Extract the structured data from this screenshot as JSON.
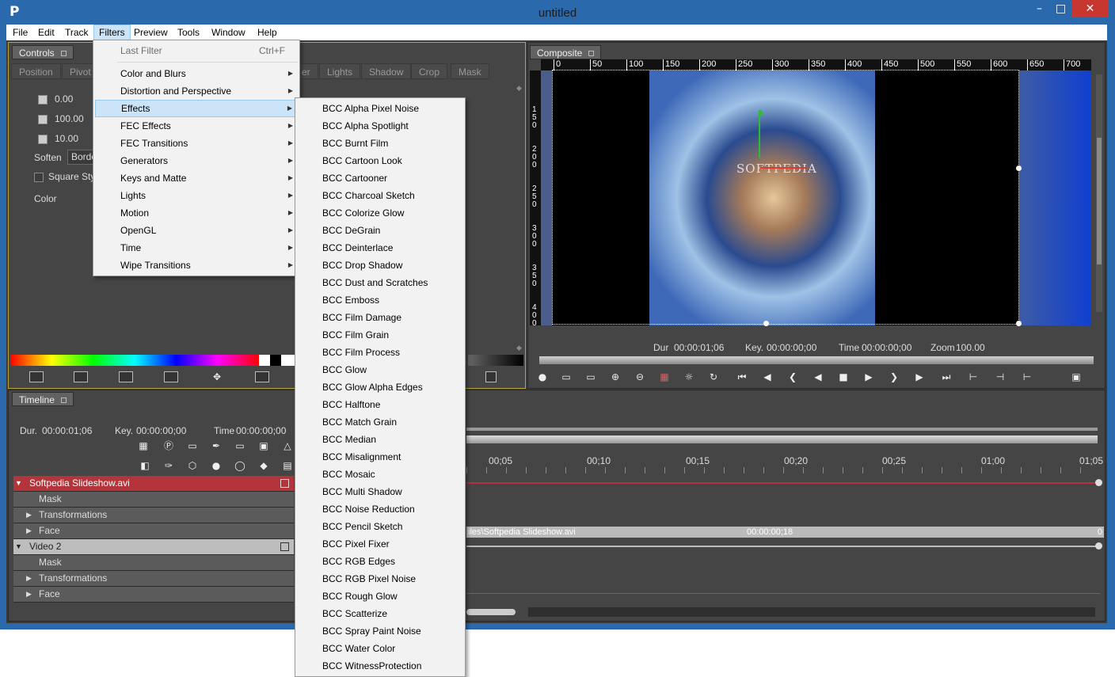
{
  "window": {
    "title": "untitled"
  },
  "menubar": [
    "File",
    "Edit",
    "Track",
    "Filters",
    "Preview",
    "Tools",
    "Window",
    "Help"
  ],
  "filters_menu": {
    "last_filter": "Last Filter",
    "last_filter_shortcut": "Ctrl+F",
    "items": [
      "Color and Blurs",
      "Distortion and Perspective",
      "Effects",
      "FEC Effects",
      "FEC Transitions",
      "Generators",
      "Keys and Matte",
      "Lights",
      "Motion",
      "OpenGL",
      "Time",
      "Wipe Transitions"
    ],
    "highlighted": "Effects"
  },
  "effects_submenu": [
    "BCC Alpha Pixel Noise",
    "BCC Alpha Spotlight",
    "BCC Burnt Film",
    "BCC Cartoon Look",
    "BCC Cartooner",
    "BCC Charcoal Sketch",
    "BCC Colorize Glow",
    "BCC DeGrain",
    "BCC Deinterlace",
    "BCC Drop Shadow",
    "BCC Dust and Scratches",
    "BCC Emboss",
    "BCC Film Damage",
    "BCC Film Grain",
    "BCC Film Process",
    "BCC Glow",
    "BCC Glow Alpha Edges",
    "BCC Halftone",
    "BCC Match Grain",
    "BCC Median",
    "BCC Misalignment",
    "BCC Mosaic",
    "BCC Multi Shadow",
    "BCC Noise Reduction",
    "BCC Pencil Sketch",
    "BCC Pixel Fixer",
    "BCC RGB Edges",
    "BCC RGB Pixel Noise",
    "BCC Rough Glow",
    "BCC Scatterize",
    "BCC Spray Paint Noise",
    "BCC Water Color",
    "BCC WitnessProtection"
  ],
  "controls": {
    "tab": "Controls",
    "subtabs": [
      "Position",
      "Pivot",
      "er",
      "Lights",
      "Shadow",
      "Crop",
      "Mask"
    ],
    "values": [
      "0.00",
      "100.00",
      "10.00"
    ],
    "soften": "Soften",
    "soften_value": "Borde",
    "square_style": "Square Style",
    "color": "Color"
  },
  "composite": {
    "tab": "Composite",
    "ruler_ticks": [
      "0",
      "50",
      "100",
      "150",
      "200",
      "250",
      "300",
      "350",
      "400",
      "450",
      "500",
      "550",
      "600",
      "650",
      "700"
    ],
    "vruler": [
      "150",
      "200",
      "250",
      "300",
      "350",
      "400"
    ],
    "dur_label": "Dur",
    "dur": "00:00:01;06",
    "key_label": "Key.",
    "key": "00:00:00;00",
    "time_label": "Time",
    "time": "00:00:00;00",
    "zoom_label": "Zoom",
    "zoom": "100.00",
    "watermark": "SOFTPEDIA"
  },
  "timeline": {
    "tab": "Timeline",
    "dur_label": "Dur.",
    "dur": "00:00:01;06",
    "key_label": "Key.",
    "key": "00:00:00;00",
    "time_label": "Time",
    "time": "00:00:00;00",
    "ticks": [
      "00;05",
      "00;10",
      "00;15",
      "00;20",
      "00;25",
      "01;00",
      "01;05"
    ],
    "tracks": [
      {
        "name": "Softpedia Slideshow.avi",
        "type": "main"
      },
      {
        "name": "Mask",
        "type": "sub"
      },
      {
        "name": "Transformations",
        "type": "expand"
      },
      {
        "name": "Face",
        "type": "expand"
      },
      {
        "name": "Video 2",
        "type": "main2"
      },
      {
        "name": "Mask",
        "type": "sub"
      },
      {
        "name": "Transformations",
        "type": "expand"
      },
      {
        "name": "Face",
        "type": "expand"
      }
    ],
    "clip_path": "iles\\Softpedia Slideshow.avi",
    "clip_time": "00:00:00;18",
    "clip_end": "0"
  },
  "colors": {
    "menu_highlight": "#cce4f7",
    "track_red": "#b3343a",
    "titlebar": "#2b69ad"
  }
}
